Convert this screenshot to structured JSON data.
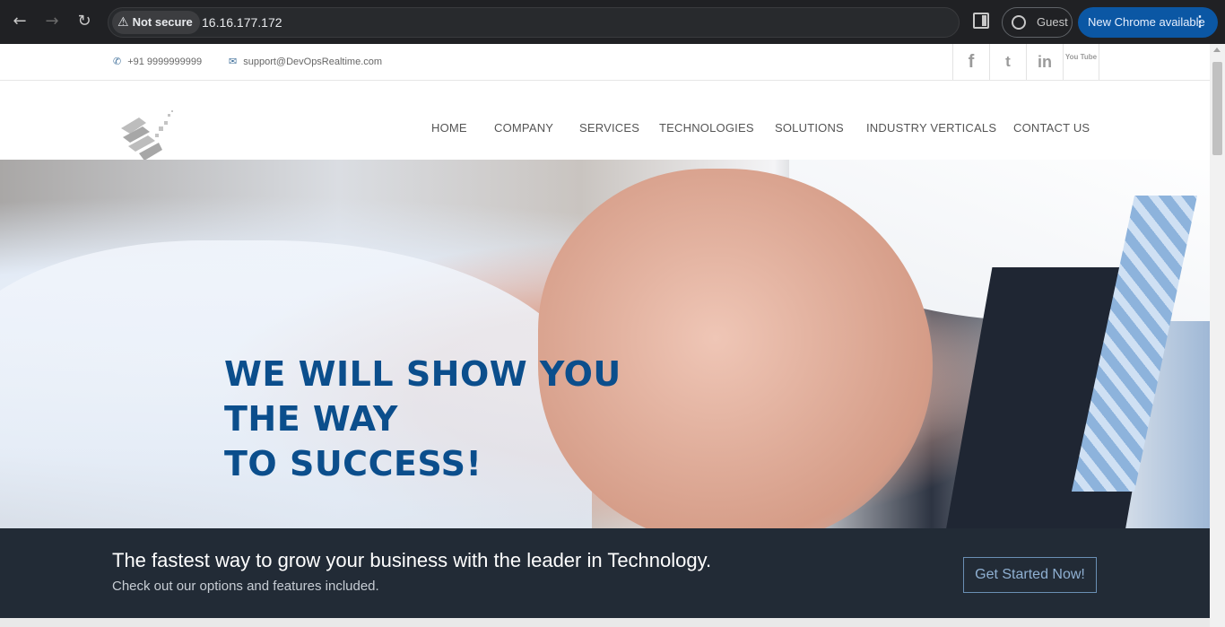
{
  "browser": {
    "security_label": "Not secure",
    "url": "16.16.177.172",
    "profile_label": "Guest",
    "update_label": "New Chrome available"
  },
  "topbar": {
    "phone": "+91 9999999999",
    "email": "support@DevOpsRealtime.com",
    "social": [
      "f",
      "t",
      "in",
      "You Tube"
    ]
  },
  "nav": {
    "items": [
      "HOME",
      "COMPANY",
      "SERVICES",
      "TECHNOLOGIES",
      "SOLUTIONS",
      "INDUSTRY VERTICALS",
      "CONTACT US"
    ]
  },
  "hero": {
    "line1": "WE WILL SHOW YOU",
    "line2": "THE WAY",
    "line3": "TO SUCCESS!"
  },
  "cta": {
    "heading": "The fastest way to grow your business with the leader in Technology.",
    "subheading": "Check out our options and features included.",
    "button_label": "Get Started Now!"
  },
  "colors": {
    "hero_title": "#0b4e8c",
    "cta_background": "#222b36",
    "chrome_update": "#0b57a4"
  }
}
